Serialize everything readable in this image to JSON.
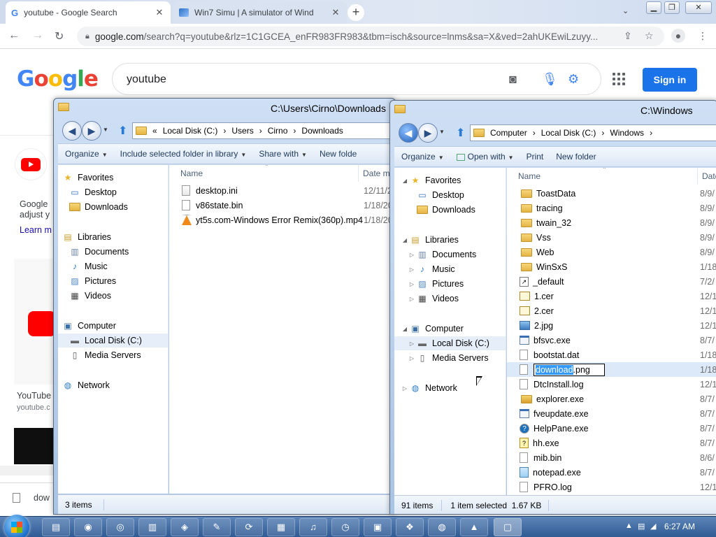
{
  "chrome": {
    "tabs": [
      {
        "title": "youtube - Google Search",
        "active": true
      },
      {
        "title": "Win7 Simu | A simulator of Wind",
        "active": false
      }
    ],
    "new_tab": "+",
    "close_glyph": "✕",
    "url_host": "google.com",
    "url_path": "/search?q=youtube&rlz=1C1GCEA_enFR983FR983&tbm=isch&source=lnms&sa=X&ved=2ahUKEwiLzuyy..."
  },
  "google": {
    "logo": {
      "G": "G",
      "o1": "o",
      "o2": "o",
      "g": "g",
      "l": "l",
      "e": "e"
    },
    "logo_colors": [
      "#4285f4",
      "#ea4335",
      "#fbbc05",
      "#4285f4",
      "#34a853",
      "#ea4335"
    ],
    "query": "youtube",
    "sign_in": "Sign in",
    "text1": "Google",
    "text2": "adjust y",
    "learn_more": "Learn m",
    "youtube_label": "YouTube",
    "youtube_url": "youtube.c",
    "download_item": "dow"
  },
  "win_left": {
    "title": "C:\\Users\\Cirno\\Downloads",
    "address": [
      "«",
      "Local Disk (C:)",
      "›",
      "Users",
      "›",
      "Cirno",
      "›",
      "Downloads"
    ],
    "commands": [
      {
        "label": "Organize",
        "dd": true
      },
      {
        "label": "Include selected folder in library",
        "dd": true
      },
      {
        "label": "Share with",
        "dd": true
      },
      {
        "label": "New folde",
        "dd": false
      }
    ],
    "col_name": "Name",
    "col_date": "Date m",
    "nav": [
      {
        "label": "Favorites",
        "icon": "star-icon",
        "level": 0
      },
      {
        "label": "Desktop",
        "icon": "desktop-icon",
        "level": 1
      },
      {
        "label": "Downloads",
        "icon": "folder-icon",
        "level": 1
      },
      {
        "label": "Libraries",
        "icon": "libraries-icon",
        "level": 0
      },
      {
        "label": "Documents",
        "icon": "documents-icon",
        "level": 1
      },
      {
        "label": "Music",
        "icon": "music-icon",
        "level": 1
      },
      {
        "label": "Pictures",
        "icon": "pictures-icon",
        "level": 1
      },
      {
        "label": "Videos",
        "icon": "videos-icon",
        "level": 1
      },
      {
        "label": "Computer",
        "icon": "computer-icon",
        "level": 0
      },
      {
        "label": "Local Disk (C:)",
        "icon": "drive-icon",
        "level": 1,
        "selected": true
      },
      {
        "label": "Media Servers",
        "icon": "media-server-icon",
        "level": 1
      },
      {
        "label": "Network",
        "icon": "network-icon",
        "level": 0
      }
    ],
    "files": [
      {
        "name": "desktop.ini",
        "date": "12/11/2",
        "icon": "ini-file-icon"
      },
      {
        "name": "v86state.bin",
        "date": "1/18/20",
        "icon": "file-icon"
      },
      {
        "name": "yt5s.com-Windows Error Remix(360p).mp4",
        "date": "1/18/20",
        "icon": "vlc-icon"
      }
    ],
    "status": "3 items"
  },
  "win_right": {
    "title": "C:\\Windows",
    "address": [
      "Computer",
      "›",
      "Local Disk (C:)",
      "›",
      "Windows",
      "›"
    ],
    "commands": [
      {
        "label": "Organize",
        "dd": true
      },
      {
        "label": "Open with",
        "dd": true
      },
      {
        "label": "Print",
        "dd": false
      },
      {
        "label": "New folder",
        "dd": false
      }
    ],
    "col_name": "Name",
    "col_date": "Date",
    "nav": [
      {
        "label": "Favorites",
        "icon": "star-icon",
        "level": 0
      },
      {
        "label": "Desktop",
        "icon": "desktop-icon",
        "level": 1
      },
      {
        "label": "Downloads",
        "icon": "folder-icon",
        "level": 1
      },
      {
        "label": "Libraries",
        "icon": "libraries-icon",
        "level": 0
      },
      {
        "label": "Documents",
        "icon": "documents-icon",
        "level": 1
      },
      {
        "label": "Music",
        "icon": "music-icon",
        "level": 1
      },
      {
        "label": "Pictures",
        "icon": "pictures-icon",
        "level": 1
      },
      {
        "label": "Videos",
        "icon": "videos-icon",
        "level": 1
      },
      {
        "label": "Computer",
        "icon": "computer-icon",
        "level": 0
      },
      {
        "label": "Local Disk (C:)",
        "icon": "drive-icon",
        "level": 1,
        "selected": true
      },
      {
        "label": "Media Servers",
        "icon": "media-server-icon",
        "level": 1
      },
      {
        "label": "Network",
        "icon": "network-icon",
        "level": 0
      }
    ],
    "files": [
      {
        "name": "ToastData",
        "date": "8/9/",
        "icon": "folder-icon"
      },
      {
        "name": "tracing",
        "date": "8/9/",
        "icon": "folder-icon"
      },
      {
        "name": "twain_32",
        "date": "8/9/",
        "icon": "folder-icon"
      },
      {
        "name": "Vss",
        "date": "8/9/",
        "icon": "folder-icon"
      },
      {
        "name": "Web",
        "date": "8/9/",
        "icon": "folder-icon"
      },
      {
        "name": "WinSxS",
        "date": "1/18",
        "icon": "folder-icon"
      },
      {
        "name": "_default",
        "date": "7/2/",
        "icon": "shortcut-icon"
      },
      {
        "name": "1.cer",
        "date": "12/1",
        "icon": "certificate-icon"
      },
      {
        "name": "2.cer",
        "date": "12/1",
        "icon": "certificate-icon"
      },
      {
        "name": "2.jpg",
        "date": "12/1",
        "icon": "image-file-icon"
      },
      {
        "name": "bfsvc.exe",
        "date": "8/7/",
        "icon": "exe-icon"
      },
      {
        "name": "bootstat.dat",
        "date": "1/18",
        "icon": "file-icon"
      },
      {
        "name": "download.png",
        "date": "1/18",
        "icon": "file-icon",
        "renaming": true,
        "hl": "download",
        "rest": ".png"
      },
      {
        "name": "DtcInstall.log",
        "date": "12/1",
        "icon": "file-icon"
      },
      {
        "name": "explorer.exe",
        "date": "8/7/",
        "icon": "explorer-icon"
      },
      {
        "name": "fveupdate.exe",
        "date": "8/7/",
        "icon": "exe-icon"
      },
      {
        "name": "HelpPane.exe",
        "date": "8/7/",
        "icon": "help-icon"
      },
      {
        "name": "hh.exe",
        "date": "8/7/",
        "icon": "help-doc-icon"
      },
      {
        "name": "mib.bin",
        "date": "8/6/",
        "icon": "file-icon"
      },
      {
        "name": "notepad.exe",
        "date": "8/7/",
        "icon": "notepad-icon"
      },
      {
        "name": "PFRO.log",
        "date": "12/1",
        "icon": "file-icon"
      }
    ],
    "status_items": "91 items",
    "status_sel": "1 item selected  1.67 KB"
  },
  "taskbar": {
    "clock": "6:27 AM",
    "buttons": [
      {
        "icon": "explorer-taskbar-icon",
        "glyph": "▤"
      },
      {
        "icon": "firefox-icon",
        "glyph": "◉"
      },
      {
        "icon": "chrome-icon",
        "glyph": "◎"
      },
      {
        "icon": "notepad-taskbar-icon",
        "glyph": "▥"
      },
      {
        "icon": "app-icon",
        "glyph": "◈"
      },
      {
        "icon": "paint-icon",
        "glyph": "✎"
      },
      {
        "icon": "refresh-icon",
        "glyph": "⟳"
      },
      {
        "icon": "calculator-icon",
        "glyph": "▦"
      },
      {
        "icon": "media-icon",
        "glyph": "♫"
      },
      {
        "icon": "clock-icon",
        "glyph": "◷"
      },
      {
        "icon": "image-viewer-icon",
        "glyph": "▣"
      },
      {
        "icon": "network-app-icon",
        "glyph": "❖"
      },
      {
        "icon": "globe-icon",
        "glyph": "◍"
      },
      {
        "icon": "vlc-taskbar-icon",
        "glyph": "▲"
      },
      {
        "icon": "remote-icon",
        "glyph": "▢"
      }
    ],
    "tray_up": "▲",
    "tray_net": "▤",
    "tray_vol": "◢"
  }
}
